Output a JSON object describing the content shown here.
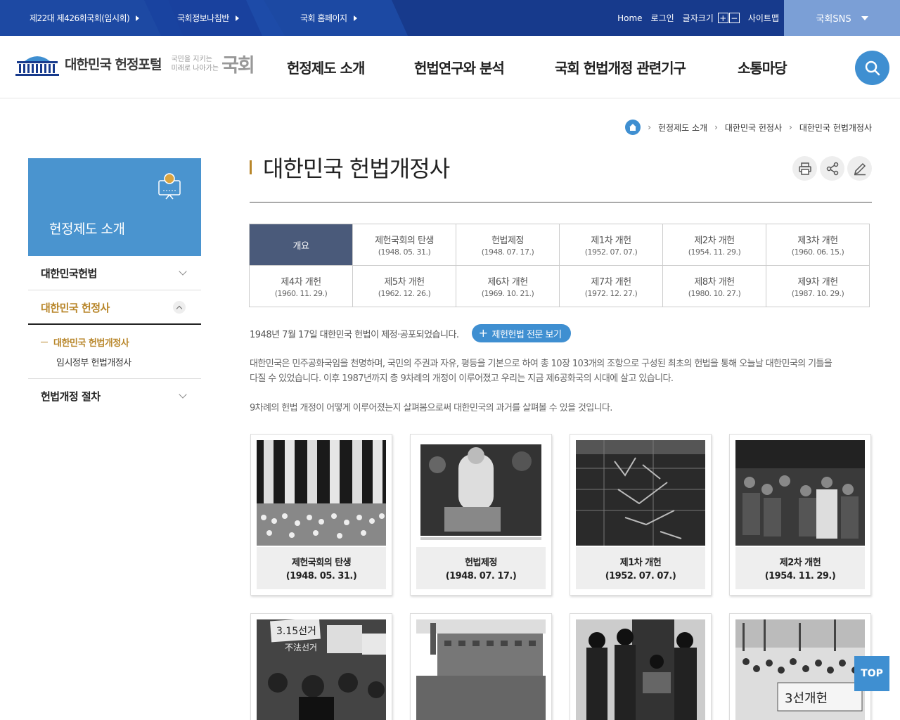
{
  "topbar": {
    "links": [
      {
        "label": "제22대 제426회국회(임시회)"
      },
      {
        "label": "국회정보나침반"
      },
      {
        "label": "국회 홈페이지"
      }
    ],
    "util": {
      "home": "Home",
      "login": "로그인",
      "font_size": "글자크기",
      "plus": "+",
      "minus": "−",
      "sitemap": "사이트맵"
    },
    "sns": "국회SNS"
  },
  "header": {
    "logo_title": "대한민국 헌정포털",
    "slogan_small_1": "국민을 지키는",
    "slogan_small_2": "미래로 나아가는",
    "slogan_big": "국회",
    "nav": [
      {
        "label": "헌정제도 소개"
      },
      {
        "label": "헌법연구와 분석"
      },
      {
        "label": "국회 헌법개정 관련기구"
      },
      {
        "label": "소통마당"
      }
    ]
  },
  "breadcrumb": [
    "헌정제도 소개",
    "대한민국 헌정사",
    "대한민국 헌법개정사"
  ],
  "sidebar": {
    "title": "헌정제도 소개",
    "items": [
      {
        "label": "대한민국헌법"
      },
      {
        "label": "대한민국 헌정사"
      },
      {
        "label": "헌법개정 절차"
      }
    ],
    "sub": [
      {
        "label": "대한민국 헌법개정사"
      },
      {
        "label": "임시정부 헌법개정사"
      }
    ]
  },
  "page": {
    "title": "대한민국 헌법개정사",
    "tabs": [
      {
        "name": "개요",
        "date": ""
      },
      {
        "name": "제헌국회의 탄생",
        "date": "(1948. 05. 31.)"
      },
      {
        "name": "헌법제정",
        "date": "(1948. 07. 17.)"
      },
      {
        "name": "제1차 개헌",
        "date": "(1952. 07. 07.)"
      },
      {
        "name": "제2차 개헌",
        "date": "(1954. 11. 29.)"
      },
      {
        "name": "제3차 개헌",
        "date": "(1960. 06. 15.)"
      },
      {
        "name": "제4차 개헌",
        "date": "(1960. 11. 29.)"
      },
      {
        "name": "제5차 개헌",
        "date": "(1962. 12. 26.)"
      },
      {
        "name": "제6차 개헌",
        "date": "(1969. 10. 21.)"
      },
      {
        "name": "제7차 개헌",
        "date": "(1972. 12. 27.)"
      },
      {
        "name": "제8차 개헌",
        "date": "(1980. 10. 27.)"
      },
      {
        "name": "제9차 개헌",
        "date": "(1987. 10. 29.)"
      }
    ],
    "intro": "1948년 7월 17일 대한민국 헌법이 제정·공포되었습니다.",
    "intro_button": "제헌헌법 전문 보기",
    "para1_line1": "대한민국은 민주공화국임을 천명하며, 국민의 주권과 자유, 평등을 기본으로 하여 총 10장 103개의 조항으로 구성된 최초의 헌법을 통해 오늘날 대한민국의 기틀을",
    "para1_line2": "다질 수 있었습니다. 이후 1987년까지 총 9차례의 개정이 이루어졌고 우리는 지금 제6공화국의 시대에 살고 있습니다.",
    "para2": "9차례의 헌법 개정이 어떻게 이루어졌는지 살펴봄으로써 대한민국의 과거를 살펴볼 수 있을 것입니다.",
    "cards": [
      {
        "title": "제헌국회의 탄생",
        "date": "(1948. 05. 31.)"
      },
      {
        "title": "헌법제정",
        "date": "(1948. 07. 17.)"
      },
      {
        "title": "제1차 개헌",
        "date": "(1952. 07. 07.)"
      },
      {
        "title": "제2차 개헌",
        "date": "(1954. 11. 29.)"
      }
    ],
    "photo_text": {
      "sign_3_15": "3.15선거",
      "sign_illegal": "不法선거",
      "sign_3rd": "3선개헌"
    }
  },
  "top_button": "TOP",
  "colors": {
    "topbar": "#173a8c",
    "accent_blue": "#3f8fd1",
    "sidebar_head": "#4a94cf",
    "active_tab": "#4a5a7a",
    "gold": "#b8862a"
  }
}
